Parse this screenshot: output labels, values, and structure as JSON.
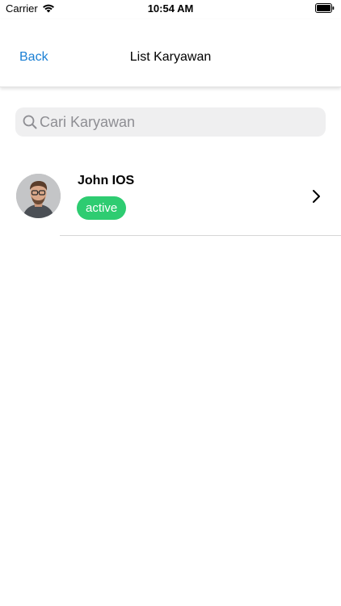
{
  "status_bar": {
    "carrier": "Carrier",
    "time": "10:54 AM",
    "icons": [
      "wifi-icon",
      "battery-icon"
    ]
  },
  "nav": {
    "back_label": "Back",
    "title": "List Karyawan"
  },
  "search": {
    "placeholder": "Cari Karyawan",
    "value": ""
  },
  "employees": [
    {
      "name": "John IOS",
      "status": "active",
      "avatar": "avatar-photo"
    }
  ],
  "colors": {
    "accent": "#1a7fd4",
    "status_active": "#2ecc71",
    "search_bg": "#efeff0"
  }
}
